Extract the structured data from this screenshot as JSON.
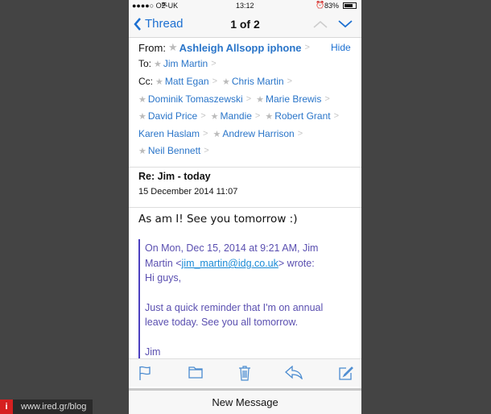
{
  "status": {
    "carrier": "●●●●○ O2-UK",
    "time": "13:12",
    "battery": "83%"
  },
  "nav": {
    "back": "Thread",
    "title": "1 of 2"
  },
  "header": {
    "from_label": "From:",
    "from": "Ashleigh Allsopp iphone",
    "hide": "Hide",
    "to_label": "To:",
    "to": "Jim Martin",
    "cc_label": "Cc:",
    "cc_rows": [
      [
        {
          "name": "Matt Egan",
          "star": true
        },
        {
          "name": "Chris Martin",
          "star": true
        }
      ],
      [
        {
          "name": "Dominik Tomaszewski",
          "star": true
        },
        {
          "name": "Marie Brewis",
          "star": true
        }
      ],
      [
        {
          "name": "David Price",
          "star": true
        },
        {
          "name": "Mandie",
          "star": true
        },
        {
          "name": "Robert Grant",
          "star": true
        }
      ],
      [
        {
          "name": "Karen Haslam",
          "star": false
        },
        {
          "name": "Andrew Harrison",
          "star": true
        }
      ],
      [
        {
          "name": "Neil Bennett",
          "star": true
        }
      ]
    ]
  },
  "subject": "Re: Jim - today",
  "date": "15 December 2014 11:07",
  "body": "As am I! See you tomorrow :)",
  "quote": {
    "line1": "On Mon, Dec 15, 2014 at 9:21 AM, Jim",
    "line2_pre": "Martin <",
    "email": "jim_martin@idg.co.uk",
    "line2_post": "> wrote:",
    "greeting": "Hi guys,",
    "p1": "Just a quick reminder that I'm on annual",
    "p2": "leave today. See you all tomorrow.",
    "sign": "Jim"
  },
  "toolbar": {
    "icons": [
      "flag-icon",
      "folder-icon",
      "trash-icon",
      "reply-icon",
      "compose-icon"
    ]
  },
  "new_message": "New Message",
  "watermark": {
    "logo": "i",
    "text": "www.ired.gr/blog"
  },
  "colors": {
    "accent": "#1b6fd1",
    "quote": "#5a4fb0",
    "quote_bar": "#4b3fc0"
  }
}
